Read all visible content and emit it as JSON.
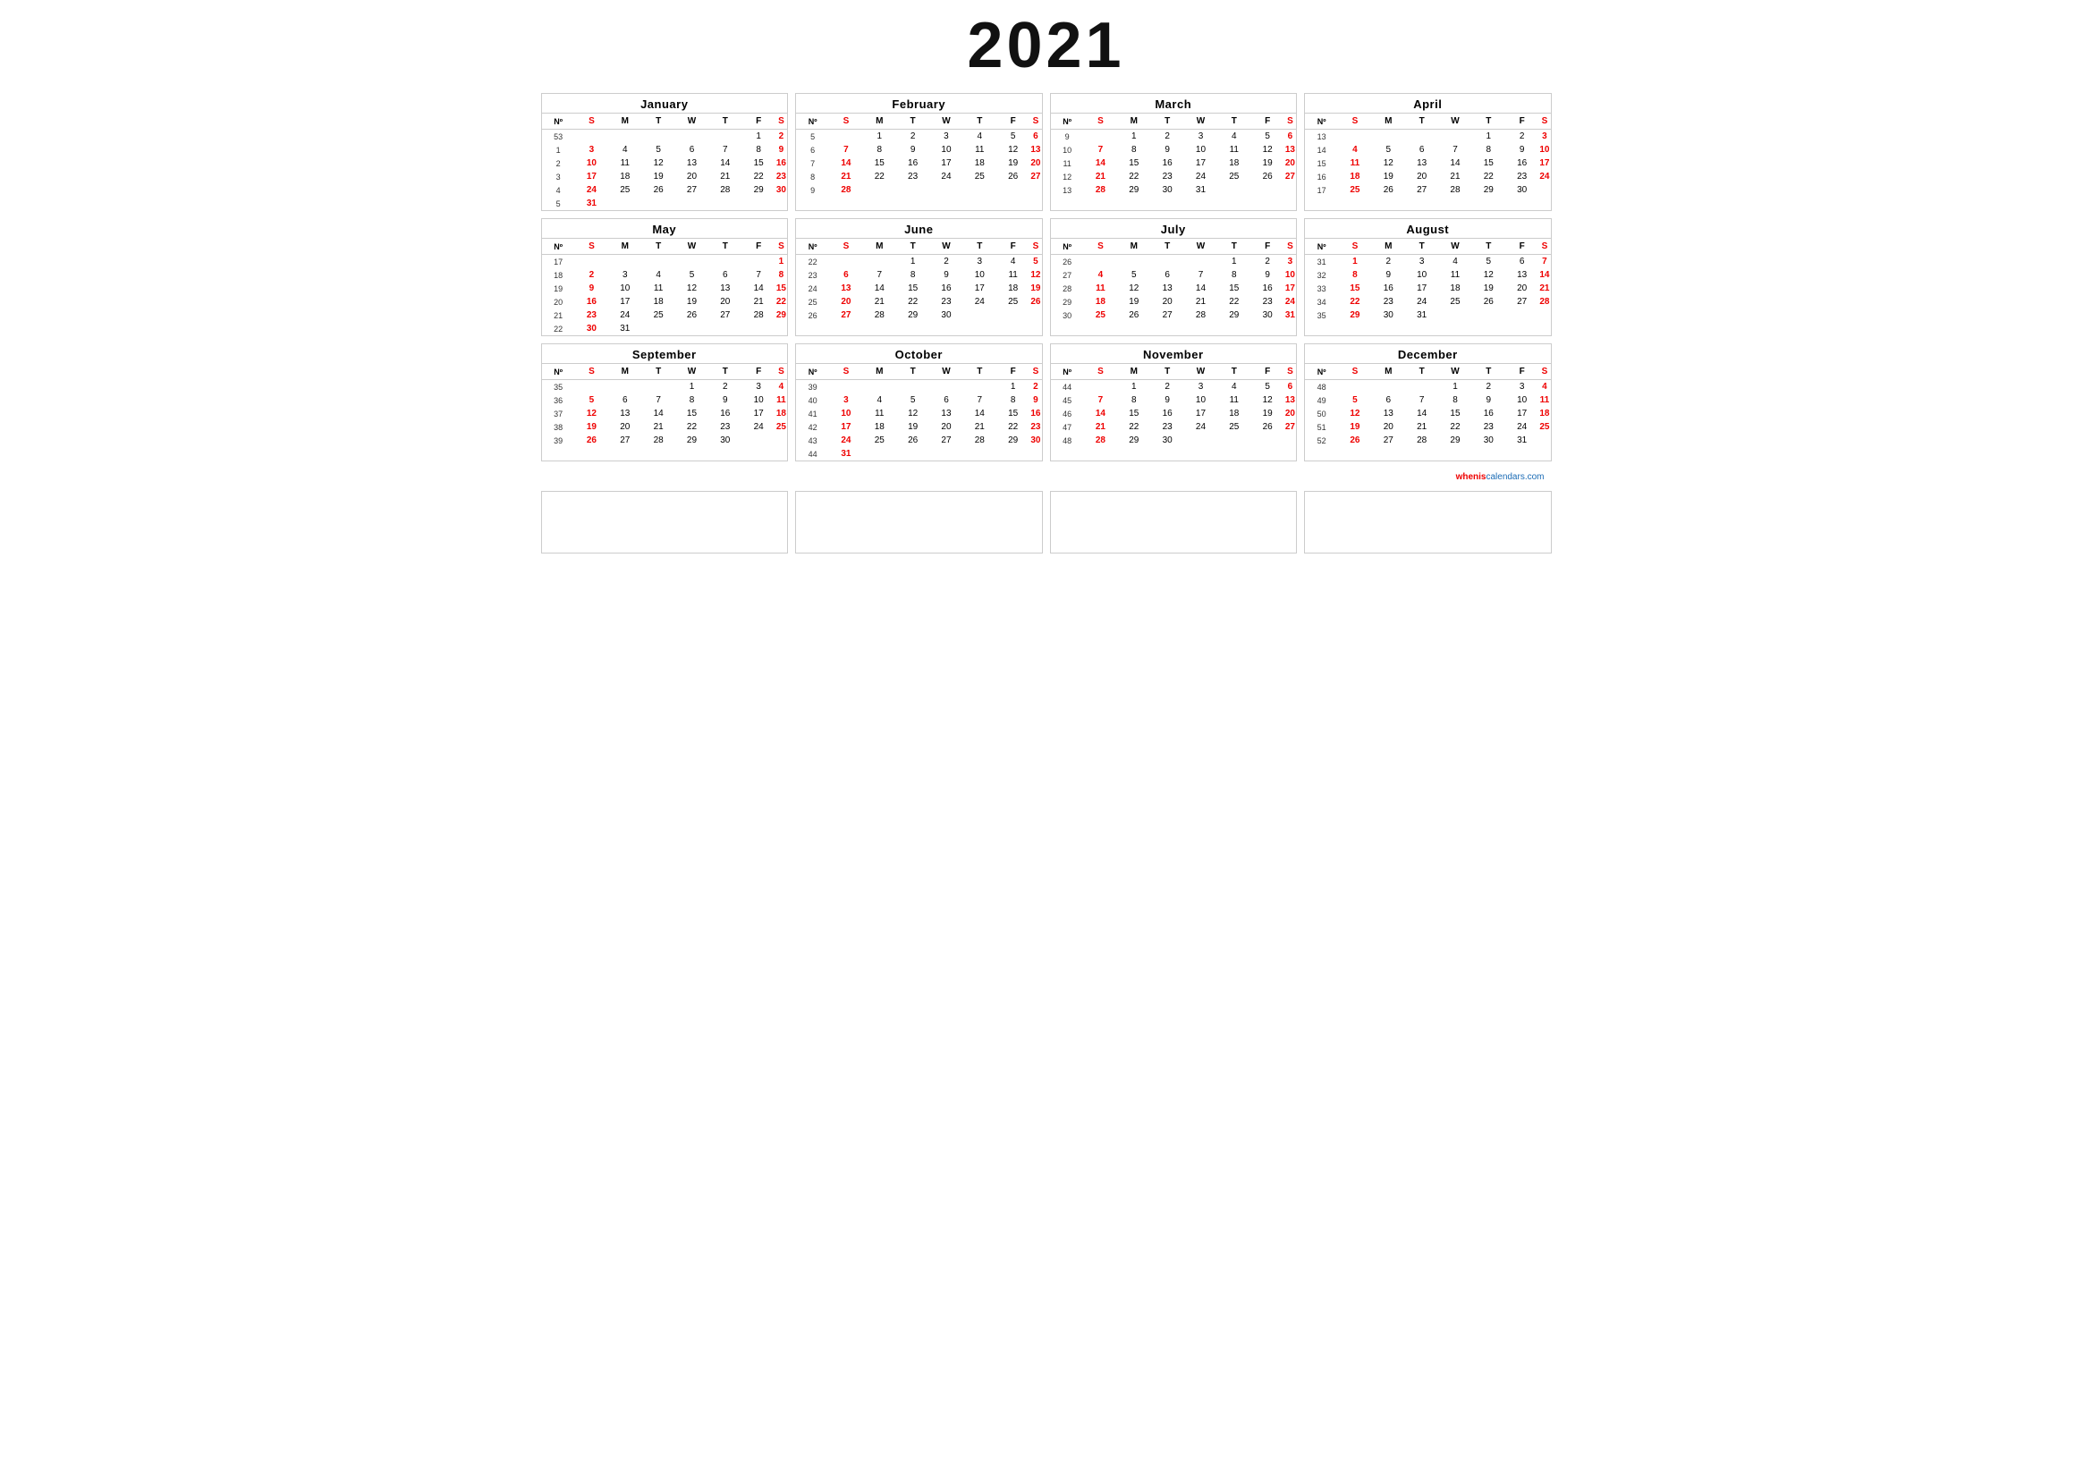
{
  "year": "2021",
  "months": [
    {
      "name": "January",
      "weeks": [
        {
          "wk": "53",
          "days": [
            "",
            "",
            "",
            "",
            "",
            "1",
            "2"
          ]
        },
        {
          "wk": "1",
          "days": [
            "3",
            "4",
            "5",
            "6",
            "7",
            "8",
            "9"
          ]
        },
        {
          "wk": "2",
          "days": [
            "10",
            "11",
            "12",
            "13",
            "14",
            "15",
            "16"
          ]
        },
        {
          "wk": "3",
          "days": [
            "17",
            "18",
            "19",
            "20",
            "21",
            "22",
            "23"
          ]
        },
        {
          "wk": "4",
          "days": [
            "24",
            "25",
            "26",
            "27",
            "28",
            "29",
            "30"
          ]
        },
        {
          "wk": "5",
          "days": [
            "31",
            "",
            "",
            "",
            "",
            "",
            ""
          ]
        }
      ]
    },
    {
      "name": "February",
      "weeks": [
        {
          "wk": "5",
          "days": [
            "",
            "1",
            "2",
            "3",
            "4",
            "5",
            "6"
          ]
        },
        {
          "wk": "6",
          "days": [
            "7",
            "8",
            "9",
            "10",
            "11",
            "12",
            "13"
          ]
        },
        {
          "wk": "7",
          "days": [
            "14",
            "15",
            "16",
            "17",
            "18",
            "19",
            "20"
          ]
        },
        {
          "wk": "8",
          "days": [
            "21",
            "22",
            "23",
            "24",
            "25",
            "26",
            "27"
          ]
        },
        {
          "wk": "9",
          "days": [
            "28",
            "",
            "",
            "",
            "",
            "",
            ""
          ]
        }
      ]
    },
    {
      "name": "March",
      "weeks": [
        {
          "wk": "9",
          "days": [
            "",
            "1",
            "2",
            "3",
            "4",
            "5",
            "6"
          ]
        },
        {
          "wk": "10",
          "days": [
            "7",
            "8",
            "9",
            "10",
            "11",
            "12",
            "13"
          ]
        },
        {
          "wk": "11",
          "days": [
            "14",
            "15",
            "16",
            "17",
            "18",
            "19",
            "20"
          ]
        },
        {
          "wk": "12",
          "days": [
            "21",
            "22",
            "23",
            "24",
            "25",
            "26",
            "27"
          ]
        },
        {
          "wk": "13",
          "days": [
            "28",
            "29",
            "30",
            "31",
            "",
            "",
            ""
          ]
        }
      ]
    },
    {
      "name": "April",
      "weeks": [
        {
          "wk": "13",
          "days": [
            "",
            "",
            "",
            "",
            "1",
            "2",
            "3"
          ]
        },
        {
          "wk": "14",
          "days": [
            "4",
            "5",
            "6",
            "7",
            "8",
            "9",
            "10"
          ]
        },
        {
          "wk": "15",
          "days": [
            "11",
            "12",
            "13",
            "14",
            "15",
            "16",
            "17"
          ]
        },
        {
          "wk": "16",
          "days": [
            "18",
            "19",
            "20",
            "21",
            "22",
            "23",
            "24"
          ]
        },
        {
          "wk": "17",
          "days": [
            "25",
            "26",
            "27",
            "28",
            "29",
            "30",
            ""
          ]
        }
      ]
    },
    {
      "name": "May",
      "weeks": [
        {
          "wk": "17",
          "days": [
            "",
            "",
            "",
            "",
            "",
            "",
            "1"
          ]
        },
        {
          "wk": "18",
          "days": [
            "2",
            "3",
            "4",
            "5",
            "6",
            "7",
            "8"
          ]
        },
        {
          "wk": "19",
          "days": [
            "9",
            "10",
            "11",
            "12",
            "13",
            "14",
            "15"
          ]
        },
        {
          "wk": "20",
          "days": [
            "16",
            "17",
            "18",
            "19",
            "20",
            "21",
            "22"
          ]
        },
        {
          "wk": "21",
          "days": [
            "23",
            "24",
            "25",
            "26",
            "27",
            "28",
            "29"
          ]
        },
        {
          "wk": "22",
          "days": [
            "30",
            "31",
            "",
            "",
            "",
            "",
            ""
          ]
        }
      ]
    },
    {
      "name": "June",
      "weeks": [
        {
          "wk": "22",
          "days": [
            "",
            "",
            "1",
            "2",
            "3",
            "4",
            "5"
          ]
        },
        {
          "wk": "23",
          "days": [
            "6",
            "7",
            "8",
            "9",
            "10",
            "11",
            "12"
          ]
        },
        {
          "wk": "24",
          "days": [
            "13",
            "14",
            "15",
            "16",
            "17",
            "18",
            "19"
          ]
        },
        {
          "wk": "25",
          "days": [
            "20",
            "21",
            "22",
            "23",
            "24",
            "25",
            "26"
          ]
        },
        {
          "wk": "26",
          "days": [
            "27",
            "28",
            "29",
            "30",
            "",
            "",
            ""
          ]
        }
      ]
    },
    {
      "name": "July",
      "weeks": [
        {
          "wk": "26",
          "days": [
            "",
            "",
            "",
            "",
            "1",
            "2",
            "3"
          ]
        },
        {
          "wk": "27",
          "days": [
            "4",
            "5",
            "6",
            "7",
            "8",
            "9",
            "10"
          ]
        },
        {
          "wk": "28",
          "days": [
            "11",
            "12",
            "13",
            "14",
            "15",
            "16",
            "17"
          ]
        },
        {
          "wk": "29",
          "days": [
            "18",
            "19",
            "20",
            "21",
            "22",
            "23",
            "24"
          ]
        },
        {
          "wk": "30",
          "days": [
            "25",
            "26",
            "27",
            "28",
            "29",
            "30",
            "31"
          ]
        }
      ]
    },
    {
      "name": "August",
      "weeks": [
        {
          "wk": "31",
          "days": [
            "1",
            "2",
            "3",
            "4",
            "5",
            "6",
            "7"
          ]
        },
        {
          "wk": "32",
          "days": [
            "8",
            "9",
            "10",
            "11",
            "12",
            "13",
            "14"
          ]
        },
        {
          "wk": "33",
          "days": [
            "15",
            "16",
            "17",
            "18",
            "19",
            "20",
            "21"
          ]
        },
        {
          "wk": "34",
          "days": [
            "22",
            "23",
            "24",
            "25",
            "26",
            "27",
            "28"
          ]
        },
        {
          "wk": "35",
          "days": [
            "29",
            "30",
            "31",
            "",
            "",
            "",
            ""
          ]
        }
      ]
    },
    {
      "name": "September",
      "weeks": [
        {
          "wk": "35",
          "days": [
            "",
            "",
            "",
            "1",
            "2",
            "3",
            "4"
          ]
        },
        {
          "wk": "36",
          "days": [
            "5",
            "6",
            "7",
            "8",
            "9",
            "10",
            "11"
          ]
        },
        {
          "wk": "37",
          "days": [
            "12",
            "13",
            "14",
            "15",
            "16",
            "17",
            "18"
          ]
        },
        {
          "wk": "38",
          "days": [
            "19",
            "20",
            "21",
            "22",
            "23",
            "24",
            "25"
          ]
        },
        {
          "wk": "39",
          "days": [
            "26",
            "27",
            "28",
            "29",
            "30",
            "",
            ""
          ]
        }
      ]
    },
    {
      "name": "October",
      "weeks": [
        {
          "wk": "39",
          "days": [
            "",
            "",
            "",
            "",
            "",
            "1",
            "2"
          ]
        },
        {
          "wk": "40",
          "days": [
            "3",
            "4",
            "5",
            "6",
            "7",
            "8",
            "9"
          ]
        },
        {
          "wk": "41",
          "days": [
            "10",
            "11",
            "12",
            "13",
            "14",
            "15",
            "16"
          ]
        },
        {
          "wk": "42",
          "days": [
            "17",
            "18",
            "19",
            "20",
            "21",
            "22",
            "23"
          ]
        },
        {
          "wk": "43",
          "days": [
            "24",
            "25",
            "26",
            "27",
            "28",
            "29",
            "30"
          ]
        },
        {
          "wk": "44",
          "days": [
            "31",
            "",
            "",
            "",
            "",
            "",
            ""
          ]
        }
      ]
    },
    {
      "name": "November",
      "weeks": [
        {
          "wk": "44",
          "days": [
            "",
            "1",
            "2",
            "3",
            "4",
            "5",
            "6"
          ]
        },
        {
          "wk": "45",
          "days": [
            "7",
            "8",
            "9",
            "10",
            "11",
            "12",
            "13"
          ]
        },
        {
          "wk": "46",
          "days": [
            "14",
            "15",
            "16",
            "17",
            "18",
            "19",
            "20"
          ]
        },
        {
          "wk": "47",
          "days": [
            "21",
            "22",
            "23",
            "24",
            "25",
            "26",
            "27"
          ]
        },
        {
          "wk": "48",
          "days": [
            "28",
            "29",
            "30",
            "",
            "",
            "",
            ""
          ]
        }
      ]
    },
    {
      "name": "December",
      "weeks": [
        {
          "wk": "48",
          "days": [
            "",
            "",
            "",
            "1",
            "2",
            "3",
            "4"
          ]
        },
        {
          "wk": "49",
          "days": [
            "5",
            "6",
            "7",
            "8",
            "9",
            "10",
            "11"
          ]
        },
        {
          "wk": "50",
          "days": [
            "12",
            "13",
            "14",
            "15",
            "16",
            "17",
            "18"
          ]
        },
        {
          "wk": "51",
          "days": [
            "19",
            "20",
            "21",
            "22",
            "23",
            "24",
            "25"
          ]
        },
        {
          "wk": "52",
          "days": [
            "26",
            "27",
            "28",
            "29",
            "30",
            "31",
            ""
          ]
        }
      ]
    }
  ],
  "headers": [
    "Nº",
    "S",
    "M",
    "T",
    "W",
    "T",
    "F",
    "S"
  ],
  "website": "wheniscalendars.com"
}
